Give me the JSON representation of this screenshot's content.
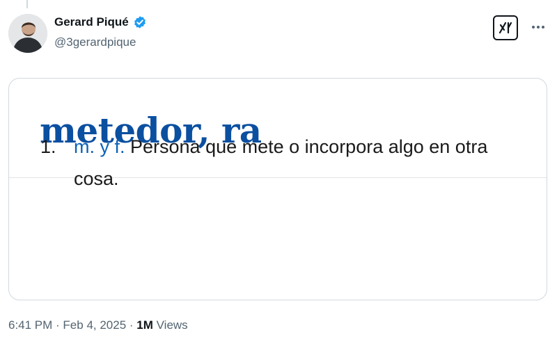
{
  "author": {
    "display_name": "Gerard Piqué",
    "handle": "@3gerardpique",
    "verified_icon": "verified-badge-icon"
  },
  "actions": {
    "grok_icon": "grok-icon",
    "more_icon": "more-horizontal-icon"
  },
  "card": {
    "headword": "metedor, ra",
    "definition_number": "1.",
    "grammar": "m. y f.",
    "definition_text": " Persona que mete o incorpora algo en otra cosa."
  },
  "meta": {
    "time": "6:41 PM",
    "sep1": " · ",
    "date": "Feb 4, 2025",
    "sep2": " · ",
    "views_count": "1M",
    "views_label": " Views"
  },
  "colors": {
    "headword": "#0b4fa0",
    "grammar": "#0b62b8",
    "verified": "#1d9bf0",
    "secondary_text": "#536471"
  }
}
